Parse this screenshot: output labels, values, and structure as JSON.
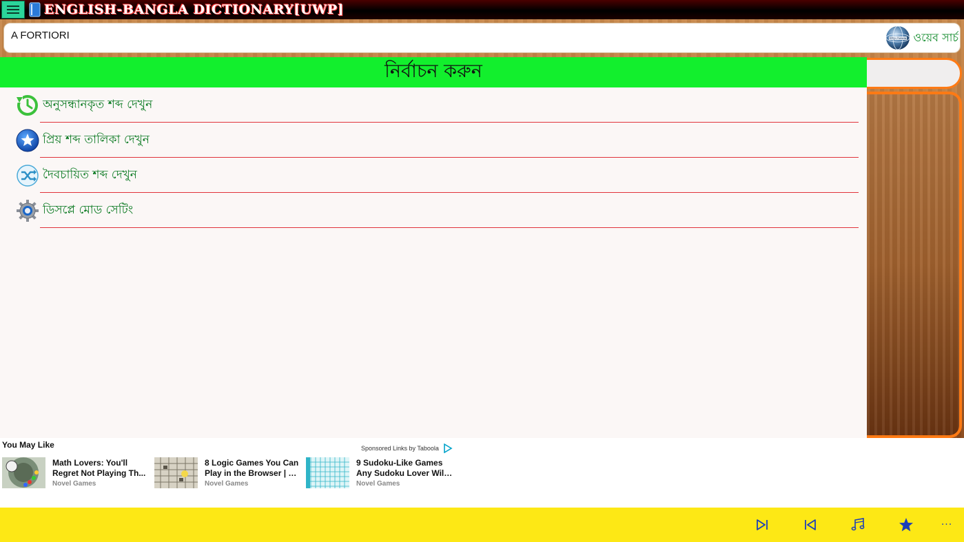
{
  "app": {
    "title": "ENGLISH-BANGLA DICTIONARY[UWP]"
  },
  "search": {
    "value": "A FORTIORI",
    "web_search_label": "ওয়েব সার্চ",
    "web_search_icon": "globe-icon"
  },
  "panel": {
    "header": "নির্বাচন করুন",
    "items": [
      {
        "label": "অনুসন্ধানকৃত শব্দ দেখুন",
        "icon": "history-icon"
      },
      {
        "label": "প্রিয় শব্দ তালিকা দেখুন",
        "icon": "star-icon"
      },
      {
        "label": "দৈবচায়িত শব্দ দেখুন",
        "icon": "shuffle-icon"
      },
      {
        "label": "ডিসপ্লে মোড সেটিং",
        "icon": "gear-icon"
      }
    ]
  },
  "ads": {
    "heading": "You May Like",
    "sponsor": "Sponsored Links by Taboola",
    "cards": [
      {
        "title_line1": "Math Lovers: You'll",
        "title_line2": "Regret Not Playing Th...",
        "source": "Novel Games"
      },
      {
        "title_line1": "8 Logic Games You Can",
        "title_line2": "Play in the Browser | N...",
        "source": "Novel Games"
      },
      {
        "title_line1": "9 Sudoku-Like Games",
        "title_line2": "Any Sudoku Lover Will...",
        "source": "Novel Games"
      }
    ]
  },
  "appbar": {
    "buttons": [
      "next-track-icon",
      "previous-track-icon",
      "music-icon",
      "star-icon",
      "more-icon"
    ],
    "more_label": "···"
  },
  "colors": {
    "header_green": "#12ef2d",
    "label_green": "#0b7a22",
    "rule_red": "#e0323a",
    "accent_orange": "#ff7a14",
    "appbar_yellow": "#fde815",
    "icon_blue": "#1d3fb8"
  }
}
